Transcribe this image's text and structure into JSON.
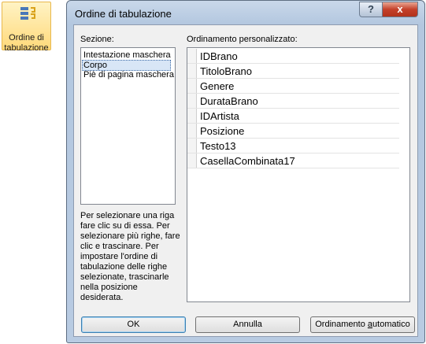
{
  "ribbon": {
    "label_line1": "Ordine di",
    "label_line2": "tabulazione"
  },
  "dialog": {
    "title": "Ordine di tabulazione",
    "help_glyph": "?",
    "close_glyph": "x",
    "sections_label": "Sezione:",
    "custom_order_label": "Ordinamento personalizzato:",
    "sections": [
      "Intestazione maschera",
      "Corpo",
      "Piè di pagina maschera"
    ],
    "selected_section": "Corpo",
    "fields": [
      "IDBrano",
      "TitoloBrano",
      "Genere",
      "DurataBrano",
      "IDArtista",
      "Posizione",
      "Testo13",
      "CasellaCombinata17"
    ],
    "help_text": "Per selezionare una riga fare clic su di essa. Per selezionare più righe, fare clic e trascinare. Per impostare l'ordine di tabulazione delle righe selezionate, trascinarle nella posizione desiderata.",
    "buttons": {
      "ok": "OK",
      "cancel": "Annulla",
      "auto_order_prefix": "Ordinamento ",
      "auto_order_accel": "a",
      "auto_order_suffix": "utomatico"
    }
  }
}
